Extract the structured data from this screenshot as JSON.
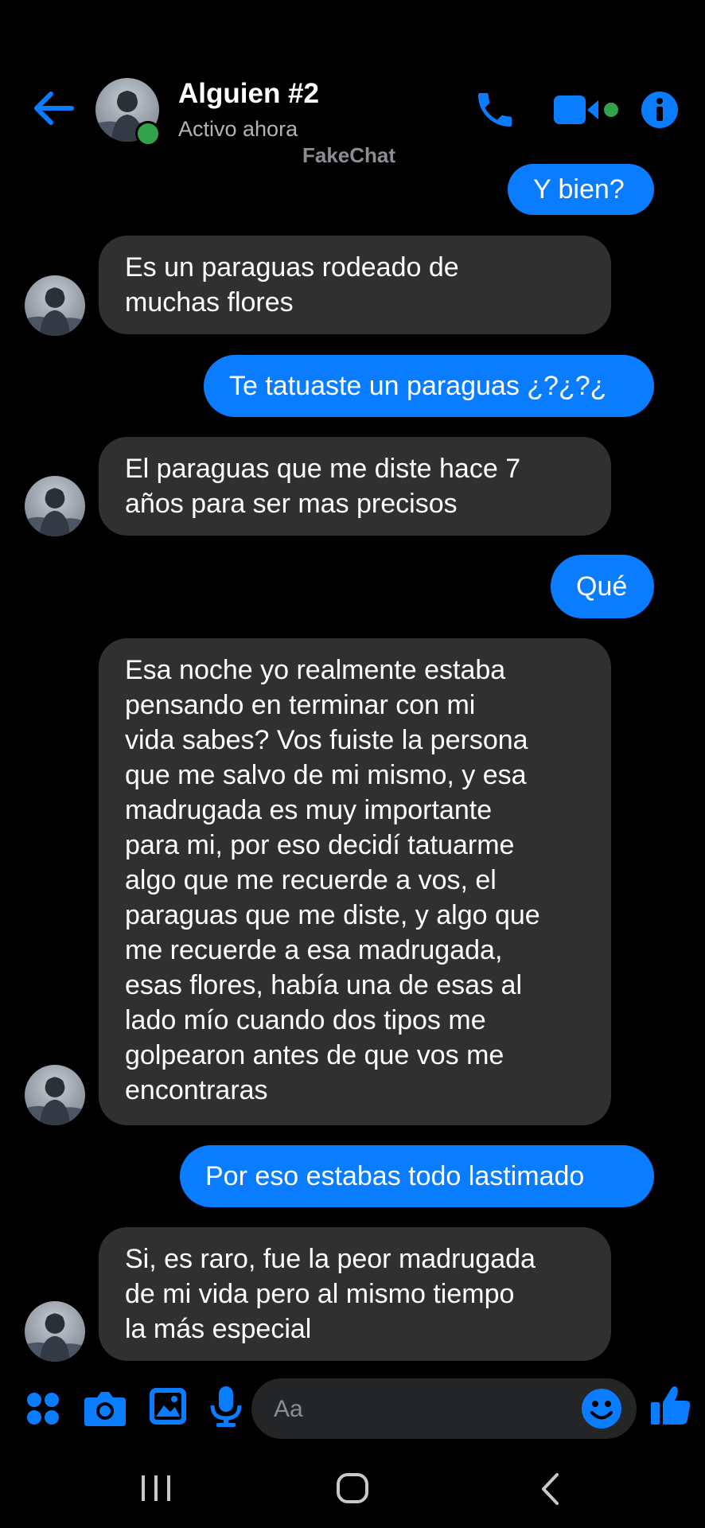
{
  "header": {
    "contact_name": "Alguien #2",
    "status": "Activo ahora",
    "watermark": "FakeChat"
  },
  "messages": [
    {
      "direction": "sent",
      "text": "Y bien?"
    },
    {
      "direction": "received",
      "lines": [
        "Es un paraguas rodeado de",
        "muchas flores"
      ]
    },
    {
      "direction": "sent",
      "text": "Te tatuaste un paraguas ¿?¿?¿"
    },
    {
      "direction": "received",
      "lines": [
        "El paraguas que me diste hace 7",
        "años para ser mas precisos"
      ]
    },
    {
      "direction": "sent",
      "text": "Qué"
    },
    {
      "direction": "received",
      "lines": [
        "Esa noche yo realmente estaba",
        "pensando en terminar con mi",
        "vida sabes? Vos fuiste la persona",
        "que me salvo de mi mismo, y esa",
        "madrugada es muy importante",
        "para mi, por eso decidí tatuarme",
        "algo que me recuerde a vos, el",
        "paraguas que me diste, y algo que",
        "me recuerde a esa madrugada,",
        "esas flores, había una de esas al",
        "lado mío cuando dos tipos me",
        "golpearon antes de que vos me",
        "encontraras"
      ]
    },
    {
      "direction": "sent",
      "text": "Por eso estabas todo lastimado"
    },
    {
      "direction": "received",
      "lines": [
        "Si, es raro, fue la peor madrugada",
        "de mi vida pero al mismo tiempo",
        "la más especial"
      ]
    }
  ],
  "composer": {
    "placeholder": "Aa"
  },
  "colors": {
    "accent": "#0a7cff",
    "received_bubble": "#303030",
    "online": "#31a24c",
    "background": "#000000"
  },
  "icons": [
    "back-arrow-icon",
    "phone-icon",
    "video-camera-icon",
    "info-icon",
    "apps-grid-icon",
    "camera-icon",
    "image-icon",
    "microphone-icon",
    "emoji-icon",
    "thumbs-up-icon",
    "recent-apps-icon",
    "home-icon",
    "back-nav-icon"
  ]
}
